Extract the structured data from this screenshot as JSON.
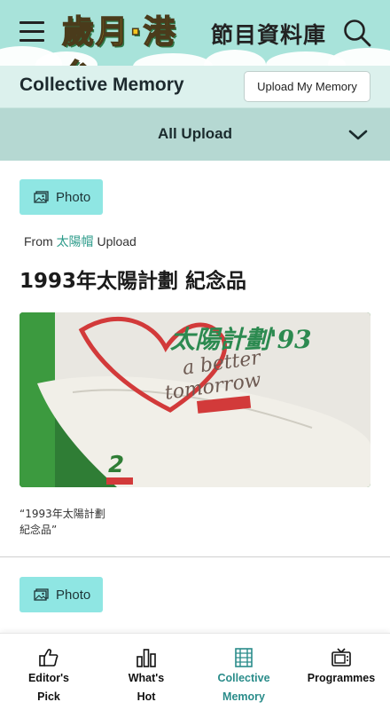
{
  "header": {
    "logo_text": "歲月·港台",
    "db_title": "節目資料庫",
    "menu_icon": "hamburger-menu-icon",
    "search_icon": "search-icon",
    "background_color": "#a8e3da"
  },
  "section": {
    "title": "Collective Memory",
    "upload_button": "Upload My Memory"
  },
  "filter": {
    "selected": "All Upload",
    "icon": "chevron-down-icon"
  },
  "cards": [
    {
      "type_label": "Photo",
      "type_icon": "photo-icon",
      "from_prefix": "From",
      "from_user": "太陽帽",
      "from_suffix": "Upload",
      "title": "1993年太陽計劃 紀念品",
      "caption_line1": "“1993年太陽計劃",
      "caption_line2": "紀念品”"
    },
    {
      "type_label": "Photo",
      "type_icon": "photo-icon"
    }
  ],
  "bottom_nav": [
    {
      "label": "Editor's\nPick",
      "icon": "thumbs-up-icon",
      "active": false
    },
    {
      "label": "What's\nHot",
      "icon": "bar-chart-icon",
      "active": false
    },
    {
      "label": "Collective\nMemory",
      "icon": "film-strip-icon",
      "active": true
    },
    {
      "label": "Programmes",
      "icon": "tv-icon",
      "active": false
    }
  ],
  "colors": {
    "accent": "#2a8c8a",
    "badge": "#8fe6e3",
    "filter_bar": "#b5d8d2",
    "section_bar": "#dcf1ed"
  }
}
